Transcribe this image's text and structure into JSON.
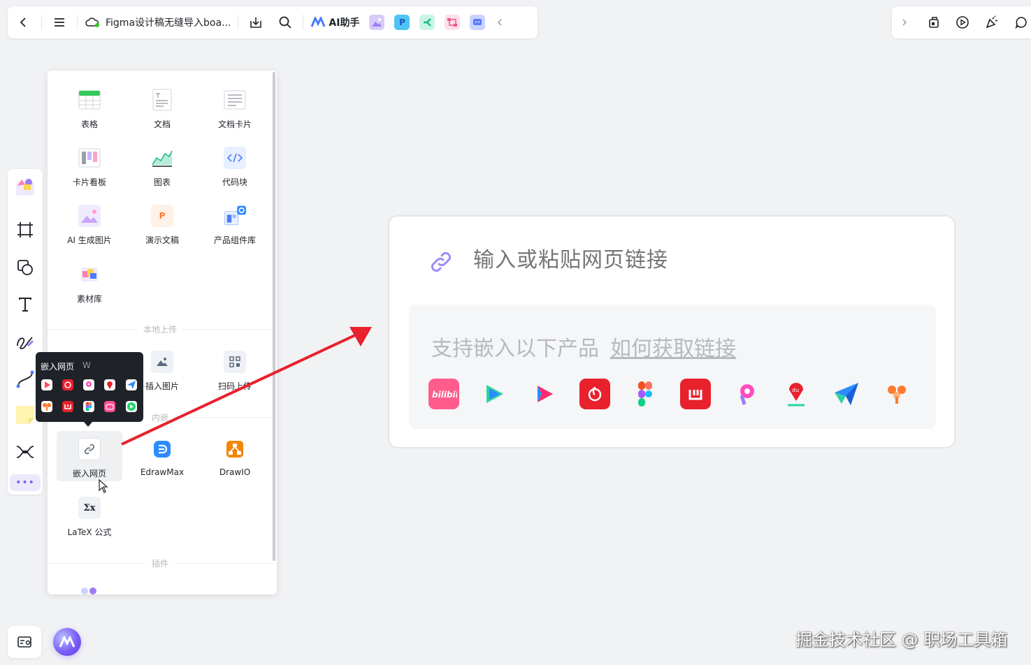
{
  "topbar": {
    "doc_title": "Figma设计稿无缝导入boa...",
    "ai_label": "AI助手"
  },
  "panel": {
    "items": [
      {
        "label": "表格",
        "icon": "table-icon"
      },
      {
        "label": "文档",
        "icon": "doc-icon"
      },
      {
        "label": "文档卡片",
        "icon": "doc-card-icon"
      },
      {
        "label": "卡片看板",
        "icon": "kanban-icon"
      },
      {
        "label": "图表",
        "icon": "chart-icon"
      },
      {
        "label": "代码块",
        "icon": "code-block-icon"
      },
      {
        "label": "AI 生成图片",
        "icon": "ai-image-icon"
      },
      {
        "label": "演示文稿",
        "icon": "slides-icon"
      },
      {
        "label": "产品组件库",
        "icon": "component-library-icon"
      },
      {
        "label": "素材库",
        "icon": "assets-icon"
      }
    ],
    "section_local": "本地上传",
    "local_items": [
      {
        "label": "插入图片",
        "icon": "insert-image-icon"
      },
      {
        "label": "扫码上传",
        "icon": "qr-upload-icon"
      }
    ],
    "section_embed": "内嵌",
    "embed_items": [
      {
        "label": "嵌入网页",
        "icon": "embed-web-icon"
      },
      {
        "label": "EdrawMax",
        "icon": "edrawmax-icon"
      },
      {
        "label": "DrawIO",
        "icon": "drawio-icon"
      },
      {
        "label": "LaTeX 公式",
        "icon": "latex-icon"
      }
    ],
    "section_plugins": "插件"
  },
  "tooltip": {
    "title": "嵌入网页",
    "shortcut": "W"
  },
  "embed_card": {
    "placeholder": "输入或粘贴网页链接",
    "support_text": "支持嵌入以下产品",
    "howto_link": "如何获取链接",
    "products": [
      "bilibili",
      "tencent-video",
      "youku",
      "netease-music",
      "figma",
      "youdao",
      "pixso",
      "baidu-map",
      "feishu",
      "orange"
    ]
  },
  "watermark": "掘金技术社区 @ 职场工具箱",
  "colors": {
    "accent": "#7a5af8",
    "arrow": "#e8212d"
  }
}
